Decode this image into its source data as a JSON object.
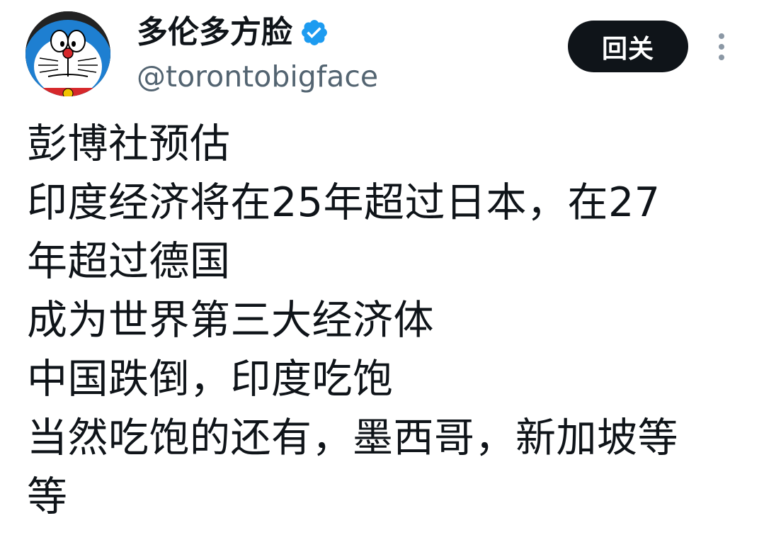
{
  "author": {
    "display_name": "多伦多方脸",
    "handle": "@torontobigface",
    "verified": true,
    "avatar_icon": "doraemon-avatar-icon"
  },
  "actions": {
    "follow_label": "回关",
    "more_icon": "more-vertical-icon"
  },
  "tweet": {
    "lines": [
      "彭博社预估",
      "印度经济将在25年超过日本，在27",
      "年超过德国",
      "成为世界第三大经济体",
      "中国跌倒，印度吃饱",
      "当然吃饱的还有，墨西哥，新加坡等",
      "等"
    ]
  },
  "colors": {
    "text_primary": "#0f1419",
    "text_secondary": "#536471",
    "follow_bg": "#0f1419",
    "follow_text": "#ffffff",
    "verified_blue": "#1d9bf0",
    "icon_gray": "#8b98a5"
  }
}
